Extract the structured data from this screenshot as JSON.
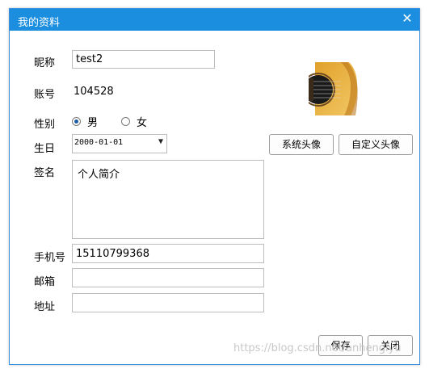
{
  "window": {
    "title": "我的资料",
    "close_glyph": "✕"
  },
  "form": {
    "nickname": {
      "label": "昵称",
      "value": "test2"
    },
    "account": {
      "label": "账号",
      "value": "104528"
    },
    "gender": {
      "label": "性别",
      "male": "男",
      "female": "女",
      "selected": "男"
    },
    "birthday": {
      "label": "生日",
      "value": "2000-01-01"
    },
    "signature": {
      "label": "签名",
      "value": "个人简介"
    },
    "phone": {
      "label": "手机号",
      "value": "15110799368"
    },
    "email": {
      "label": "邮箱",
      "value": ""
    },
    "address": {
      "label": "地址",
      "value": ""
    }
  },
  "avatar": {
    "icon": "guitar-icon",
    "system_button": "系统头像",
    "custom_button": "自定义头像"
  },
  "footer": {
    "save": "保存",
    "close": "关闭"
  },
  "watermark": "https://blog.csdn.net/anhengiyu",
  "colors": {
    "titlebar": "#1b8ee0",
    "radio_dot": "#1c5aa6"
  }
}
